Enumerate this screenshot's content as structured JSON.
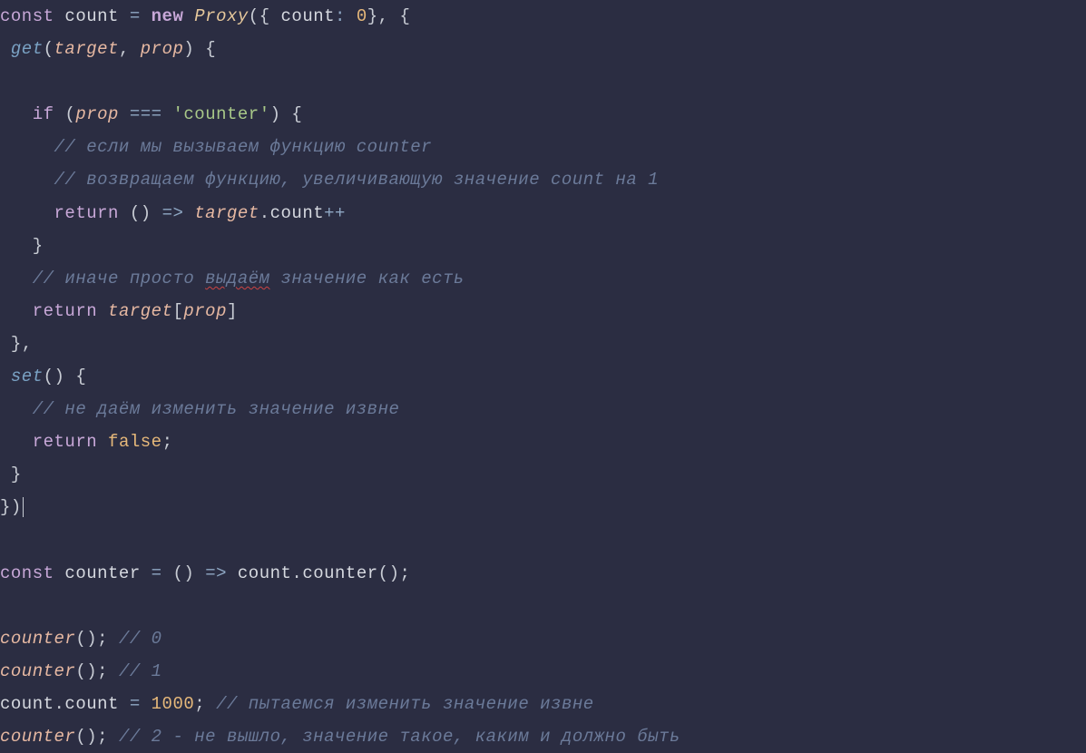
{
  "code": {
    "l1": {
      "const": "const",
      "count": "count",
      "eq": "=",
      "new": "new",
      "Proxy": "Proxy",
      "lp": "(",
      "lb": "{",
      "key": "count",
      "colon": ":",
      "zero": "0",
      "rb": "}",
      "comma": ",",
      "lb2": "{"
    },
    "l2": {
      "get": "get",
      "lp": "(",
      "target": "target",
      "comma": ",",
      "prop": "prop",
      "rp": ")",
      "lb": "{"
    },
    "l3": {
      "if": "if",
      "lp": "(",
      "prop": "prop",
      "eqeqeq": "===",
      "str": "'counter'",
      "rp": ")",
      "lb": "{"
    },
    "l4": {
      "comment": "// если мы вызываем функцию counter"
    },
    "l5": {
      "comment": "// возвращаем функцию, увеличивающую значение count на 1"
    },
    "l6": {
      "return": "return",
      "lp": "(",
      "rp": ")",
      "arrow": "=>",
      "target": "target",
      "dot": ".",
      "count": "count",
      "inc": "++"
    },
    "l7": {
      "rb": "}"
    },
    "l8": {
      "comment_a": "// иначе просто ",
      "comment_sq": "выдаём",
      "comment_b": " значение как есть"
    },
    "l9": {
      "return": "return",
      "target": "target",
      "lb": "[",
      "prop": "prop",
      "rb": "]"
    },
    "l10": {
      "rb": "}",
      "comma": ","
    },
    "l11": {
      "set": "set",
      "lp": "(",
      "rp": ")",
      "lb": "{"
    },
    "l12": {
      "comment": "// не даём изменить значение извне"
    },
    "l13": {
      "return": "return",
      "false": "false",
      "semi": ";"
    },
    "l14": {
      "rb": "}"
    },
    "l15": {
      "rb": "}",
      "rp": ")"
    },
    "l16": {
      "const": "const",
      "counter": "counter",
      "eq": "=",
      "lp": "(",
      "rp": ")",
      "arrow": "=>",
      "count": "count",
      "dot": ".",
      "countercall": "counter",
      "lp2": "(",
      "rp2": ")",
      "semi": ";"
    },
    "l17": {
      "counter": "counter",
      "lp": "(",
      "rp": ")",
      "semi": ";",
      "comment": "// 0"
    },
    "l18": {
      "counter": "counter",
      "lp": "(",
      "rp": ")",
      "semi": ";",
      "comment": "// 1"
    },
    "l19": {
      "count": "count",
      "dot": ".",
      "countprop": "count",
      "eq": "=",
      "thousand": "1000",
      "semi": ";",
      "comment": "// пытаемся изменить значение извне"
    },
    "l20": {
      "counter": "counter",
      "lp": "(",
      "rp": ")",
      "semi": ";",
      "comment": "// 2 - не вышло, значение такое, каким и должно быть"
    }
  }
}
